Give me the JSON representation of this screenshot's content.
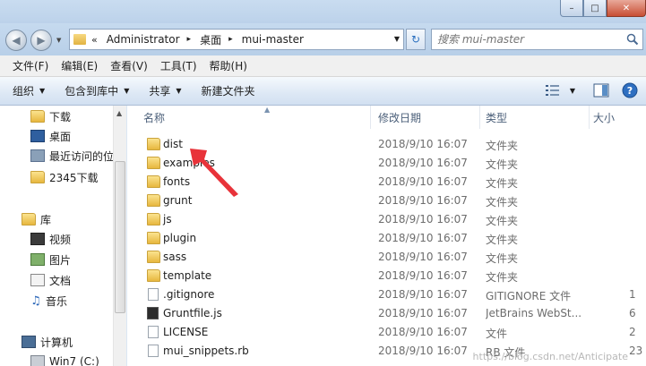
{
  "window": {
    "min_label": "–",
    "max_label": "□",
    "close_label": "✕"
  },
  "address": {
    "lead": "«",
    "crumbs": [
      "Administrator",
      "桌面",
      "mui-master"
    ],
    "sep": "▸"
  },
  "search": {
    "placeholder": "搜索 mui-master"
  },
  "menu": [
    "文件(F)",
    "编辑(E)",
    "查看(V)",
    "工具(T)",
    "帮助(H)"
  ],
  "toolbar": {
    "organize": "组织",
    "include": "包含到库中",
    "share": "共享",
    "new_folder": "新建文件夹"
  },
  "nav": {
    "favorites": [
      {
        "label": "下载",
        "icon": "download-folder-icon"
      },
      {
        "label": "桌面",
        "icon": "desktop-icon"
      },
      {
        "label": "最近访问的位",
        "icon": "recent-places-icon"
      },
      {
        "label": "2345下载",
        "icon": "folder-icon"
      }
    ],
    "library": "库",
    "libraries": [
      {
        "label": "视频",
        "icon": "video-library-icon"
      },
      {
        "label": "图片",
        "icon": "pictures-library-icon"
      },
      {
        "label": "文档",
        "icon": "documents-library-icon"
      },
      {
        "label": "音乐",
        "icon": "music-library-icon"
      }
    ],
    "computer": "计算机",
    "drive": "Win7 (C:)"
  },
  "columns": {
    "name": "名称",
    "date": "修改日期",
    "type": "类型",
    "size": "大小"
  },
  "files": [
    {
      "name": "dist",
      "date": "2018/9/10 16:07",
      "type": "文件夹",
      "size": "",
      "kind": "folder"
    },
    {
      "name": "examples",
      "date": "2018/9/10 16:07",
      "type": "文件夹",
      "size": "",
      "kind": "folder"
    },
    {
      "name": "fonts",
      "date": "2018/9/10 16:07",
      "type": "文件夹",
      "size": "",
      "kind": "folder"
    },
    {
      "name": "grunt",
      "date": "2018/9/10 16:07",
      "type": "文件夹",
      "size": "",
      "kind": "folder"
    },
    {
      "name": "js",
      "date": "2018/9/10 16:07",
      "type": "文件夹",
      "size": "",
      "kind": "folder"
    },
    {
      "name": "plugin",
      "date": "2018/9/10 16:07",
      "type": "文件夹",
      "size": "",
      "kind": "folder"
    },
    {
      "name": "sass",
      "date": "2018/9/10 16:07",
      "type": "文件夹",
      "size": "",
      "kind": "folder"
    },
    {
      "name": "template",
      "date": "2018/9/10 16:07",
      "type": "文件夹",
      "size": "",
      "kind": "folder"
    },
    {
      "name": ".gitignore",
      "date": "2018/9/10 16:07",
      "type": "GITIGNORE 文件",
      "size": "1",
      "kind": "file"
    },
    {
      "name": "Gruntfile.js",
      "date": "2018/9/10 16:07",
      "type": "JetBrains WebSt...",
      "size": "6",
      "kind": "code"
    },
    {
      "name": "LICENSE",
      "date": "2018/9/10 16:07",
      "type": "文件",
      "size": "2",
      "kind": "file"
    },
    {
      "name": "mui_snippets.rb",
      "date": "2018/9/10 16:07",
      "type": "RB 文件",
      "size": "23",
      "kind": "file"
    }
  ],
  "watermark": "https://blog.csdn.net/Anticipate"
}
